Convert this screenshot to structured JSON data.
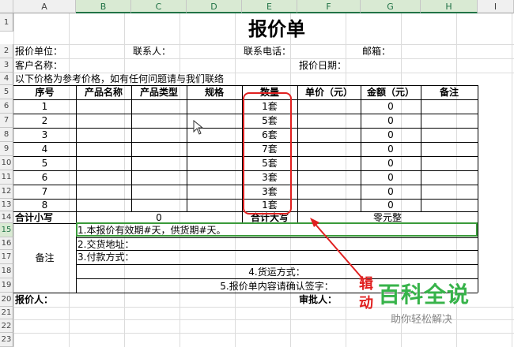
{
  "columns": [
    "A",
    "B",
    "C",
    "D",
    "E",
    "F",
    "G",
    "H",
    "I"
  ],
  "rows": [
    "1",
    "2",
    "3",
    "4",
    "5",
    "6",
    "7",
    "8",
    "9",
    "10",
    "11",
    "12",
    "13",
    "14",
    "15",
    "16",
    "17",
    "18",
    "19",
    "20",
    "21",
    "22",
    "23"
  ],
  "sheet": {
    "title": "报价单",
    "info_row1": {
      "unit": "报价单位：",
      "contact": "联系人：",
      "phone": "联系电话：",
      "email": "邮箱："
    },
    "info_row2": {
      "customer": "客户名称：",
      "date": "报价日期："
    },
    "note": "以下价格为参考价格，如有任何问题请与我们联络",
    "headers": [
      "序号",
      "产品名称",
      "产品类型",
      "规格",
      "数量",
      "单价（元）",
      "金额（元）",
      "备注"
    ],
    "items": [
      {
        "no": "1",
        "qty": "1套",
        "amount": "0"
      },
      {
        "no": "2",
        "qty": "5套",
        "amount": "0"
      },
      {
        "no": "3",
        "qty": "6套",
        "amount": "0"
      },
      {
        "no": "4",
        "qty": "7套",
        "amount": "0"
      },
      {
        "no": "5",
        "qty": "5套",
        "amount": "0"
      },
      {
        "no": "6",
        "qty": "3套",
        "amount": "0"
      },
      {
        "no": "7",
        "qty": "3套",
        "amount": "0"
      },
      {
        "no": "8",
        "qty": "1套",
        "amount": "0"
      }
    ],
    "subtotal_label": "合计小写",
    "subtotal_value": "0",
    "total_upper_label": "合计大写",
    "total_upper_value": "零元整",
    "remarks_label": "备注",
    "remarks": [
      "1.本报价有效期#天，供货期#天。",
      "2.交货地址：",
      "3.付款方式：",
      "4.货运方式：",
      "5.报价单内容请确认签字："
    ],
    "quoter_label": "报价人：",
    "approver_label": "审批人："
  },
  "watermark": {
    "main": "百科全说",
    "sub": "助你轻松解决"
  },
  "annotation_text": [
    "辑",
    "动"
  ],
  "colors": {
    "highlight_red": "#e02020",
    "selection_green": "#3a9a3a",
    "watermark_green": "#37b34a"
  }
}
